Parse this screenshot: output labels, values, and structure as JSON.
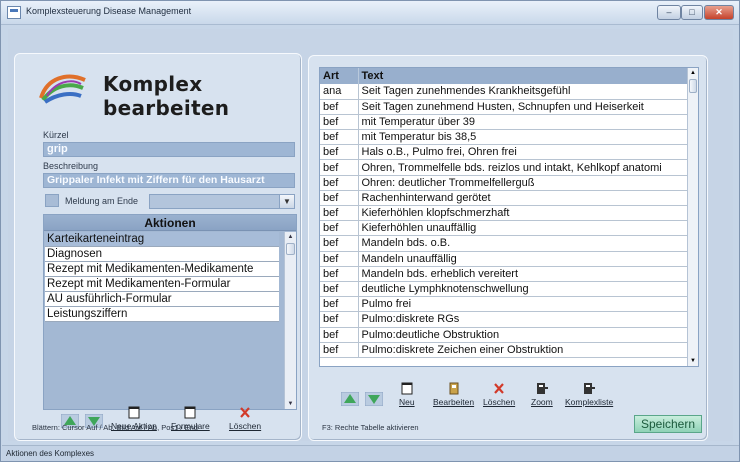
{
  "window": {
    "title": "Komplexsteuerung Disease Management"
  },
  "header": {
    "title": "Komplex bearbeiten"
  },
  "form": {
    "kuerzel_label": "Kürzel",
    "kuerzel_value": "grip",
    "beschreibung_label": "Beschreibung",
    "beschreibung_value": "Grippaler Infekt mit Ziffern für den Hausarzt",
    "meldung_label": "Meldung am Ende"
  },
  "actions": {
    "header": "Aktionen",
    "items": [
      "Karteikarteneintrag",
      "Diagnosen",
      "Rezept mit Medikamenten-Medikamente",
      "Rezept mit Medikamenten-Formular",
      "AU ausführlich-Formular",
      "Leistungsziffern"
    ],
    "selected_index": 0
  },
  "left_toolbar": {
    "new_action": "Neue Aktion",
    "forms": "Formulare",
    "delete": "Löschen"
  },
  "left_status": "Blättern: Cursor Auf / Ab, Bild Auf / Ab, Pos1 / End",
  "table": {
    "columns": [
      "Art",
      "Text"
    ],
    "rows": [
      [
        "ana",
        "Seit Tagen zunehmendes Krankheitsgefühl"
      ],
      [
        "bef",
        "Seit Tagen zunehmend Husten, Schnupfen und Heiserkeit"
      ],
      [
        "bef",
        "mit Temperatur über 39"
      ],
      [
        "bef",
        "mit Temperatur bis 38,5"
      ],
      [
        "bef",
        "Hals o.B., Pulmo frei, Ohren frei"
      ],
      [
        "bef",
        "Ohren, Trommelfelle bds. reizlos und intakt, Kehlkopf anatomi"
      ],
      [
        "bef",
        "Ohren: deutlicher Trommelfellerguß"
      ],
      [
        "bef",
        "Rachenhinterwand gerötet"
      ],
      [
        "bef",
        "Kieferhöhlen klopfschmerzhaft"
      ],
      [
        "bef",
        "Kieferhöhlen unauffällig"
      ],
      [
        "bef",
        "Mandeln bds. o.B."
      ],
      [
        "bef",
        "Mandeln unauffällig"
      ],
      [
        "bef",
        "Mandeln bds. erheblich vereitert"
      ],
      [
        "bef",
        "deutliche Lymphknotenschwellung"
      ],
      [
        "bef",
        "Pulmo frei"
      ],
      [
        "bef",
        "Pulmo:diskrete RGs"
      ],
      [
        "bef",
        "Pulmo:deutliche Obstruktion"
      ],
      [
        "bef",
        "Pulmo:diskrete Zeichen einer Obstruktion"
      ]
    ]
  },
  "right_toolbar": {
    "new": "Neu",
    "edit": "Bearbeiten",
    "delete": "Löschen",
    "zoom": "Zoom",
    "complex_list": "Komplexliste"
  },
  "right_status": "F3: Rechte Tabelle aktivieren",
  "save_button": "Speichern",
  "statusbar": "Aktionen des Komplexes",
  "colors": {
    "accent_field": "#9eb6d4",
    "table_header": "#98afcd",
    "save_green": "#8fd2b6",
    "arrow_green": "#3fa65a",
    "delete_red": "#d23a2a"
  }
}
